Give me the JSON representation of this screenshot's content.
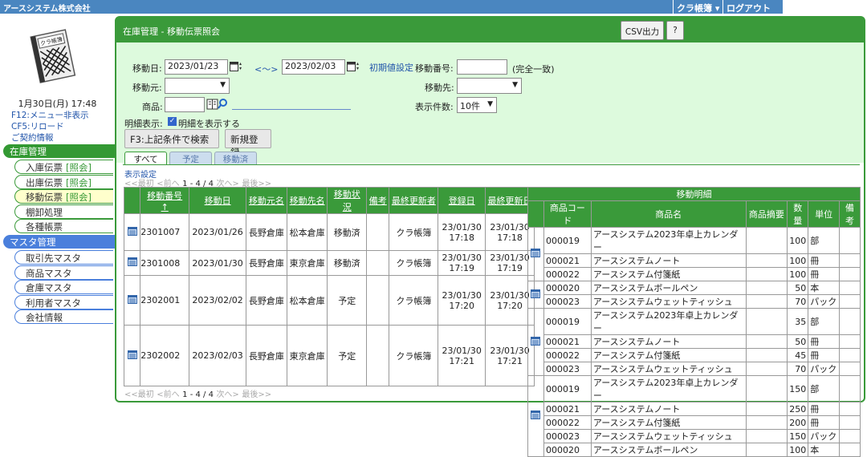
{
  "topbar": {
    "company": "アースシステム株式会社",
    "user": "クラ帳簿 ▾",
    "logout": "ログアウト"
  },
  "sidebar": {
    "logo_text": "クラ帳簿",
    "date": "1月30日(月) 17:48",
    "links": [
      "F12:メニュー非表示",
      "CF5:リロード",
      "ご契約情報"
    ],
    "sections": [
      {
        "label": "在庫管理",
        "color": "green",
        "items": [
          {
            "label": "入庫伝票",
            "sub": "[照会]"
          },
          {
            "label": "出庫伝票",
            "sub": "[照会]"
          },
          {
            "label": "移動伝票",
            "sub": "[照会]",
            "active": true
          },
          {
            "label": "棚卸処理",
            "sub": ""
          },
          {
            "label": "各種帳票",
            "sub": ""
          }
        ]
      },
      {
        "label": "マスタ管理",
        "color": "blue",
        "items": [
          {
            "label": "取引先マスタ",
            "sub": ""
          },
          {
            "label": "商品マスタ",
            "sub": ""
          },
          {
            "label": "倉庫マスタ",
            "sub": ""
          },
          {
            "label": "利用者マスタ",
            "sub": ""
          },
          {
            "label": "会社情報",
            "sub": ""
          }
        ]
      }
    ]
  },
  "header": {
    "title": "在庫管理 - 移動伝票照会",
    "csv": "CSV出力",
    "help": "?"
  },
  "search": {
    "move_date_label": "移動日:",
    "date_from": "2023/01/23",
    "range_sep": "<～>",
    "date_to": "2023/02/03",
    "reset_link": "初期値設定",
    "move_no_label": "移動番号:",
    "move_no_value": "",
    "exact": "(完全一致)",
    "from_label": "移動元:",
    "to_label": "移動先:",
    "product_label": "商品:",
    "count_label": "表示件数:",
    "count_value": "10件",
    "detail_label": "明細表示:",
    "detail_check": "明細を表示する",
    "search_btn": "F3:上記条件で検索",
    "new_btn": "新規登録"
  },
  "tabs": [
    "すべて",
    "予定",
    "移動済"
  ],
  "display_settings": "表示設定",
  "pager": {
    "first": "<<最初",
    "prev": "<前へ",
    "range": "1 - 4 / 4",
    "next": "次へ>",
    "last": "最後>>"
  },
  "list": {
    "headers": [
      "移動番号 ↑",
      "移動日",
      "移動元名",
      "移動先名",
      "移動状況",
      "備考",
      "最終更新者",
      "登録日",
      "最終更新日"
    ],
    "rows": [
      {
        "no": "2301007",
        "date": "2023/01/26",
        "from": "長野倉庫",
        "to": "松本倉庫",
        "status": "移動済",
        "note": "",
        "updater": "クラ帳簿",
        "reg1": "23/01/30",
        "reg2": "17:18",
        "upd1": "23/01/30",
        "upd2": "17:18"
      },
      {
        "no": "2301008",
        "date": "2023/01/30",
        "from": "長野倉庫",
        "to": "東京倉庫",
        "status": "移動済",
        "note": "",
        "updater": "クラ帳簿",
        "reg1": "23/01/30",
        "reg2": "17:19",
        "upd1": "23/01/30",
        "upd2": "17:19"
      },
      {
        "no": "2302001",
        "date": "2023/02/02",
        "from": "長野倉庫",
        "to": "松本倉庫",
        "status": "予定",
        "note": "",
        "updater": "クラ帳簿",
        "reg1": "23/01/30",
        "reg2": "17:20",
        "upd1": "23/01/30",
        "upd2": "17:20"
      },
      {
        "no": "2302002",
        "date": "2023/02/03",
        "from": "長野倉庫",
        "to": "東京倉庫",
        "status": "予定",
        "note": "",
        "updater": "クラ帳簿",
        "reg1": "23/01/30",
        "reg2": "17:21",
        "upd1": "23/01/30",
        "upd2": "17:21"
      }
    ]
  },
  "detail": {
    "title": "移動明細",
    "headers": [
      "商品コード",
      "商品名",
      "商品摘要",
      "数量",
      "単位",
      "備考"
    ],
    "groups": [
      [
        [
          "000019",
          "アースシステム2023年卓上カレンダー",
          "",
          "100",
          "部",
          ""
        ],
        [
          "000021",
          "アースシステムノート",
          "",
          "100",
          "冊",
          ""
        ],
        [
          "000022",
          "アースシステム付箋紙",
          "",
          "100",
          "冊",
          ""
        ]
      ],
      [
        [
          "000020",
          "アースシステムボールペン",
          "",
          "50",
          "本",
          ""
        ],
        [
          "000023",
          "アースシステムウェットティッシュ",
          "",
          "70",
          "パック",
          ""
        ]
      ],
      [
        [
          "000019",
          "アースシステム2023年卓上カレンダー",
          "",
          "35",
          "部",
          ""
        ],
        [
          "000021",
          "アースシステムノート",
          "",
          "50",
          "冊",
          ""
        ],
        [
          "000022",
          "アースシステム付箋紙",
          "",
          "45",
          "冊",
          ""
        ],
        [
          "000023",
          "アースシステムウェットティッシュ",
          "",
          "70",
          "パック",
          ""
        ]
      ],
      [
        [
          "000019",
          "アースシステム2023年卓上カレンダー",
          "",
          "150",
          "部",
          ""
        ],
        [
          "000021",
          "アースシステムノート",
          "",
          "250",
          "冊",
          ""
        ],
        [
          "000022",
          "アースシステム付箋紙",
          "",
          "200",
          "冊",
          ""
        ],
        [
          "000023",
          "アースシステムウェットティッシュ",
          "",
          "150",
          "パック",
          ""
        ],
        [
          "000020",
          "アースシステムボールペン",
          "",
          "100",
          "本",
          ""
        ]
      ]
    ]
  }
}
